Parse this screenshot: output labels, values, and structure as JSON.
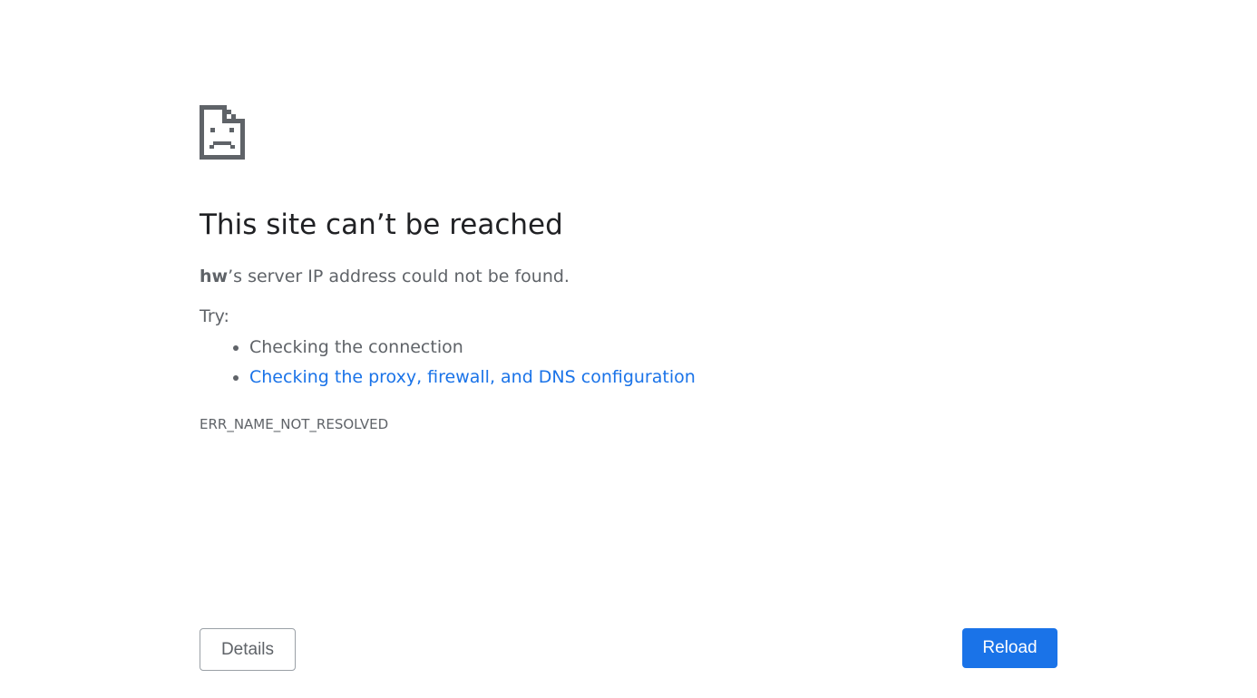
{
  "icon": "sad-page-icon",
  "colors": {
    "title": "#202124",
    "text": "#5f6368",
    "link": "#1a73e8",
    "primary_button": "#1a73e8"
  },
  "error": {
    "title": "This site can’t be reached",
    "host": "hw",
    "summary_suffix": "’s server IP address could not be found.",
    "try_label": "Try:",
    "suggestions": [
      "Checking the connection",
      "Checking the proxy, firewall, and DNS configuration"
    ],
    "code": "ERR_NAME_NOT_RESOLVED"
  },
  "buttons": {
    "details": "Details",
    "reload": "Reload"
  }
}
